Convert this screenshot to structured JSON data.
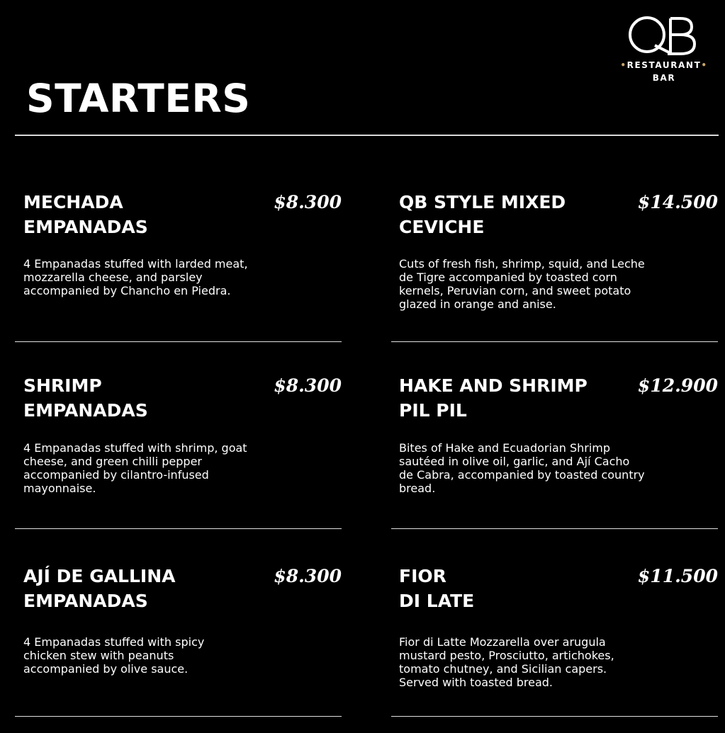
{
  "brand": {
    "logo_text": "QB",
    "line1": "RESTAURANT",
    "line2": "BAR",
    "accent_color": "#c9a46b"
  },
  "header": {
    "title": "STARTERS"
  },
  "items": [
    {
      "name_line1": "MECHADA",
      "name_line2": "EMPANADAS",
      "price": "$8.300",
      "description": "4 Empanadas stuffed with larded meat, mozzarella cheese, and parsley accompanied by Chancho en Piedra."
    },
    {
      "name_line1": "QB STYLE MIXED",
      "name_line2": "CEVICHE",
      "price": "$14.500",
      "description": "Cuts of fresh fish, shrimp, squid, and Leche de Tigre accompanied by toasted corn kernels, Peruvian corn, and sweet potato glazed in orange and anise."
    },
    {
      "name_line1": "SHRIMP",
      "name_line2": "EMPANADAS",
      "price": "$8.300",
      "description": "4 Empanadas stuffed with shrimp, goat cheese, and green chilli pepper accompanied by cilantro-infused mayonnaise."
    },
    {
      "name_line1": "HAKE AND SHRIMP",
      "name_line2": "PIL PIL",
      "price": "$12.900",
      "description": "Bites of Hake and Ecuadorian Shrimp sautéed in olive oil, garlic, and Ají Cacho de Cabra, accompanied by toasted country bread."
    },
    {
      "name_line1": "AJÍ DE GALLINA",
      "name_line2": "EMPANADAS",
      "price": "$8.300",
      "description": "4 Empanadas stuffed with spicy chicken stew with peanuts accompanied by olive sauce."
    },
    {
      "name_line1": "FIOR",
      "name_line2": "DI LATE",
      "price": "$11.500",
      "description": "Fior di Latte Mozzarella over arugula mustard pesto, Prosciutto, artichokes, tomato chutney, and Sicilian capers. Served with toasted bread."
    }
  ]
}
